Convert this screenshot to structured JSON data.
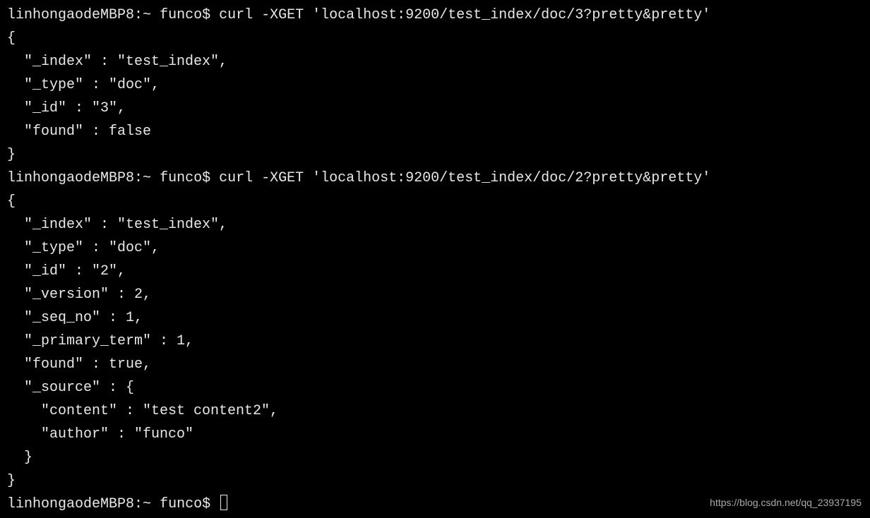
{
  "prompt1": {
    "host": "linhongaodeMBP8",
    "path": "~",
    "user": "funco",
    "command": "curl -XGET 'localhost:9200/test_index/doc/3?pretty&pretty'"
  },
  "response1": {
    "open": "{",
    "lines": [
      "  \"_index\" : \"test_index\",",
      "  \"_type\" : \"doc\",",
      "  \"_id\" : \"3\",",
      "  \"found\" : false"
    ],
    "close": "}"
  },
  "prompt2": {
    "host": "linhongaodeMBP8",
    "path": "~",
    "user": "funco",
    "command": "curl -XGET 'localhost:9200/test_index/doc/2?pretty&pretty'"
  },
  "response2": {
    "open": "{",
    "lines": [
      "  \"_index\" : \"test_index\",",
      "  \"_type\" : \"doc\",",
      "  \"_id\" : \"2\",",
      "  \"_version\" : 2,",
      "  \"_seq_no\" : 1,",
      "  \"_primary_term\" : 1,",
      "  \"found\" : true,",
      "  \"_source\" : {",
      "    \"content\" : \"test content2\",",
      "    \"author\" : \"funco\"",
      "  }"
    ],
    "close": "}"
  },
  "prompt3": {
    "host": "linhongaodeMBP8",
    "path": "~",
    "user": "funco",
    "command": ""
  },
  "watermark": "https://blog.csdn.net/qq_23937195"
}
